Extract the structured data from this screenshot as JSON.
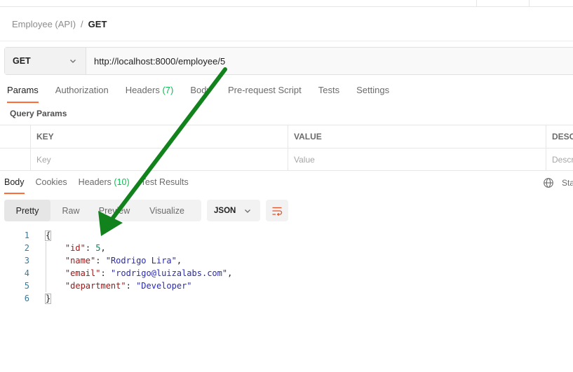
{
  "breadcrumb": {
    "parent": "Employee (API)",
    "separator": "/",
    "current": "GET"
  },
  "request": {
    "method": "GET",
    "url": "http://localhost:8000/employee/5"
  },
  "request_tabs": [
    {
      "label": "Params",
      "count": "",
      "active": true
    },
    {
      "label": "Authorization",
      "count": "",
      "active": false
    },
    {
      "label": "Headers",
      "count": "(7)",
      "active": false
    },
    {
      "label": "Body",
      "count": "",
      "active": false
    },
    {
      "label": "Pre-request Script",
      "count": "",
      "active": false
    },
    {
      "label": "Tests",
      "count": "",
      "active": false
    },
    {
      "label": "Settings",
      "count": "",
      "active": false
    }
  ],
  "query_params": {
    "title": "Query Params",
    "columns": [
      "KEY",
      "VALUE",
      "DESCRIPTION"
    ],
    "placeholders": {
      "key": "Key",
      "value": "Value",
      "description": "Description"
    }
  },
  "response_tabs": [
    {
      "label": "Body",
      "count": "",
      "active": true
    },
    {
      "label": "Cookies",
      "count": "",
      "active": false
    },
    {
      "label": "Headers",
      "count": "(10)",
      "active": false
    },
    {
      "label": "Test Results",
      "count": "",
      "active": false
    }
  ],
  "response_status_label": "Status",
  "view_modes": [
    "Pretty",
    "Raw",
    "Preview",
    "Visualize"
  ],
  "active_view_mode": "Pretty",
  "format": "JSON",
  "response_lines": [
    {
      "num": "1",
      "tokens": [
        {
          "t": "brace",
          "v": "{"
        }
      ]
    },
    {
      "num": "2",
      "tokens": [
        {
          "t": "pad",
          "v": "    "
        },
        {
          "t": "key",
          "v": "\"id\""
        },
        {
          "t": "punc",
          "v": ": "
        },
        {
          "t": "num",
          "v": "5"
        },
        {
          "t": "punc",
          "v": ","
        }
      ]
    },
    {
      "num": "3",
      "tokens": [
        {
          "t": "pad",
          "v": "    "
        },
        {
          "t": "key",
          "v": "\"name\""
        },
        {
          "t": "punc",
          "v": ": "
        },
        {
          "t": "str",
          "v": "\"Rodrigo Lira\""
        },
        {
          "t": "punc",
          "v": ","
        }
      ]
    },
    {
      "num": "4",
      "tokens": [
        {
          "t": "pad",
          "v": "    "
        },
        {
          "t": "key",
          "v": "\"email\""
        },
        {
          "t": "punc",
          "v": ": "
        },
        {
          "t": "str",
          "v": "\"rodrigo@luizalabs.com\""
        },
        {
          "t": "punc",
          "v": ","
        }
      ]
    },
    {
      "num": "5",
      "tokens": [
        {
          "t": "pad",
          "v": "    "
        },
        {
          "t": "key",
          "v": "\"department\""
        },
        {
          "t": "punc",
          "v": ": "
        },
        {
          "t": "str",
          "v": "\"Developer\""
        }
      ]
    },
    {
      "num": "6",
      "tokens": [
        {
          "t": "brace",
          "v": "}"
        }
      ]
    }
  ],
  "colors": {
    "accent_tab": "#ff6c37",
    "count": "#0cbb52",
    "json_key": "#a31515",
    "json_string": "#2a2ab0",
    "json_number": "#098658",
    "annotation_arrow": "#12821c"
  },
  "icons": {
    "method_dropdown": "chevron-down-icon",
    "format_dropdown": "chevron-down-icon",
    "wrap": "wrap-lines-icon",
    "globe": "globe-icon",
    "annotation": "arrow-annotation-icon"
  }
}
